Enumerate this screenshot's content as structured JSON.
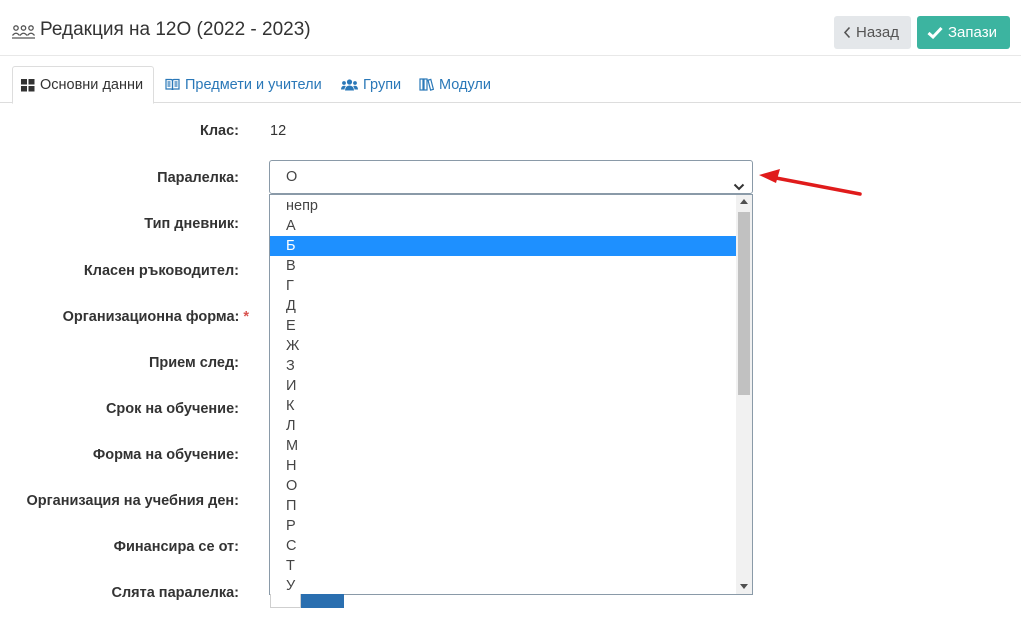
{
  "header": {
    "title": "Редакция на 12О (2022 - 2023)",
    "title_icon": "people-group-icon",
    "back_label": "Назад",
    "save_label": "Запази"
  },
  "tabs": [
    {
      "label": "Основни данни",
      "icon": "grid-icon",
      "active": true
    },
    {
      "label": "Предмети и учители",
      "icon": "book-icon",
      "active": false
    },
    {
      "label": "Групи",
      "icon": "users-icon",
      "active": false
    },
    {
      "label": "Модули",
      "icon": "books-icon",
      "active": false
    }
  ],
  "form": {
    "labels": {
      "class": "Клас:",
      "parallel": "Паралелка:",
      "diary_type": "Тип дневник:",
      "class_teacher": "Класен ръководител:",
      "org_form": "Организационна форма:",
      "admission_after": "Прием след:",
      "study_term": "Срок на обучение:",
      "study_form": "Форма на обучение:",
      "day_org": "Организация на учебния ден:",
      "financed_by": "Финансира се от:",
      "merged_parallel": "Слята паралелка:"
    },
    "required_mark": "*",
    "class_value": "12",
    "parallel_selected": "О"
  },
  "dropdown": {
    "highlighted": "Б",
    "options": [
      "непр",
      "А",
      "Б",
      "В",
      "Г",
      "Д",
      "Е",
      "Ж",
      "З",
      "И",
      "К",
      "Л",
      "М",
      "Н",
      "О",
      "П",
      "Р",
      "С",
      "Т",
      "У"
    ]
  },
  "colors": {
    "accent_save": "#3cb4a0",
    "link_blue": "#2a78b8",
    "highlight": "#1e90ff",
    "annotation_arrow": "#e01b1b",
    "required": "#d9534f"
  }
}
